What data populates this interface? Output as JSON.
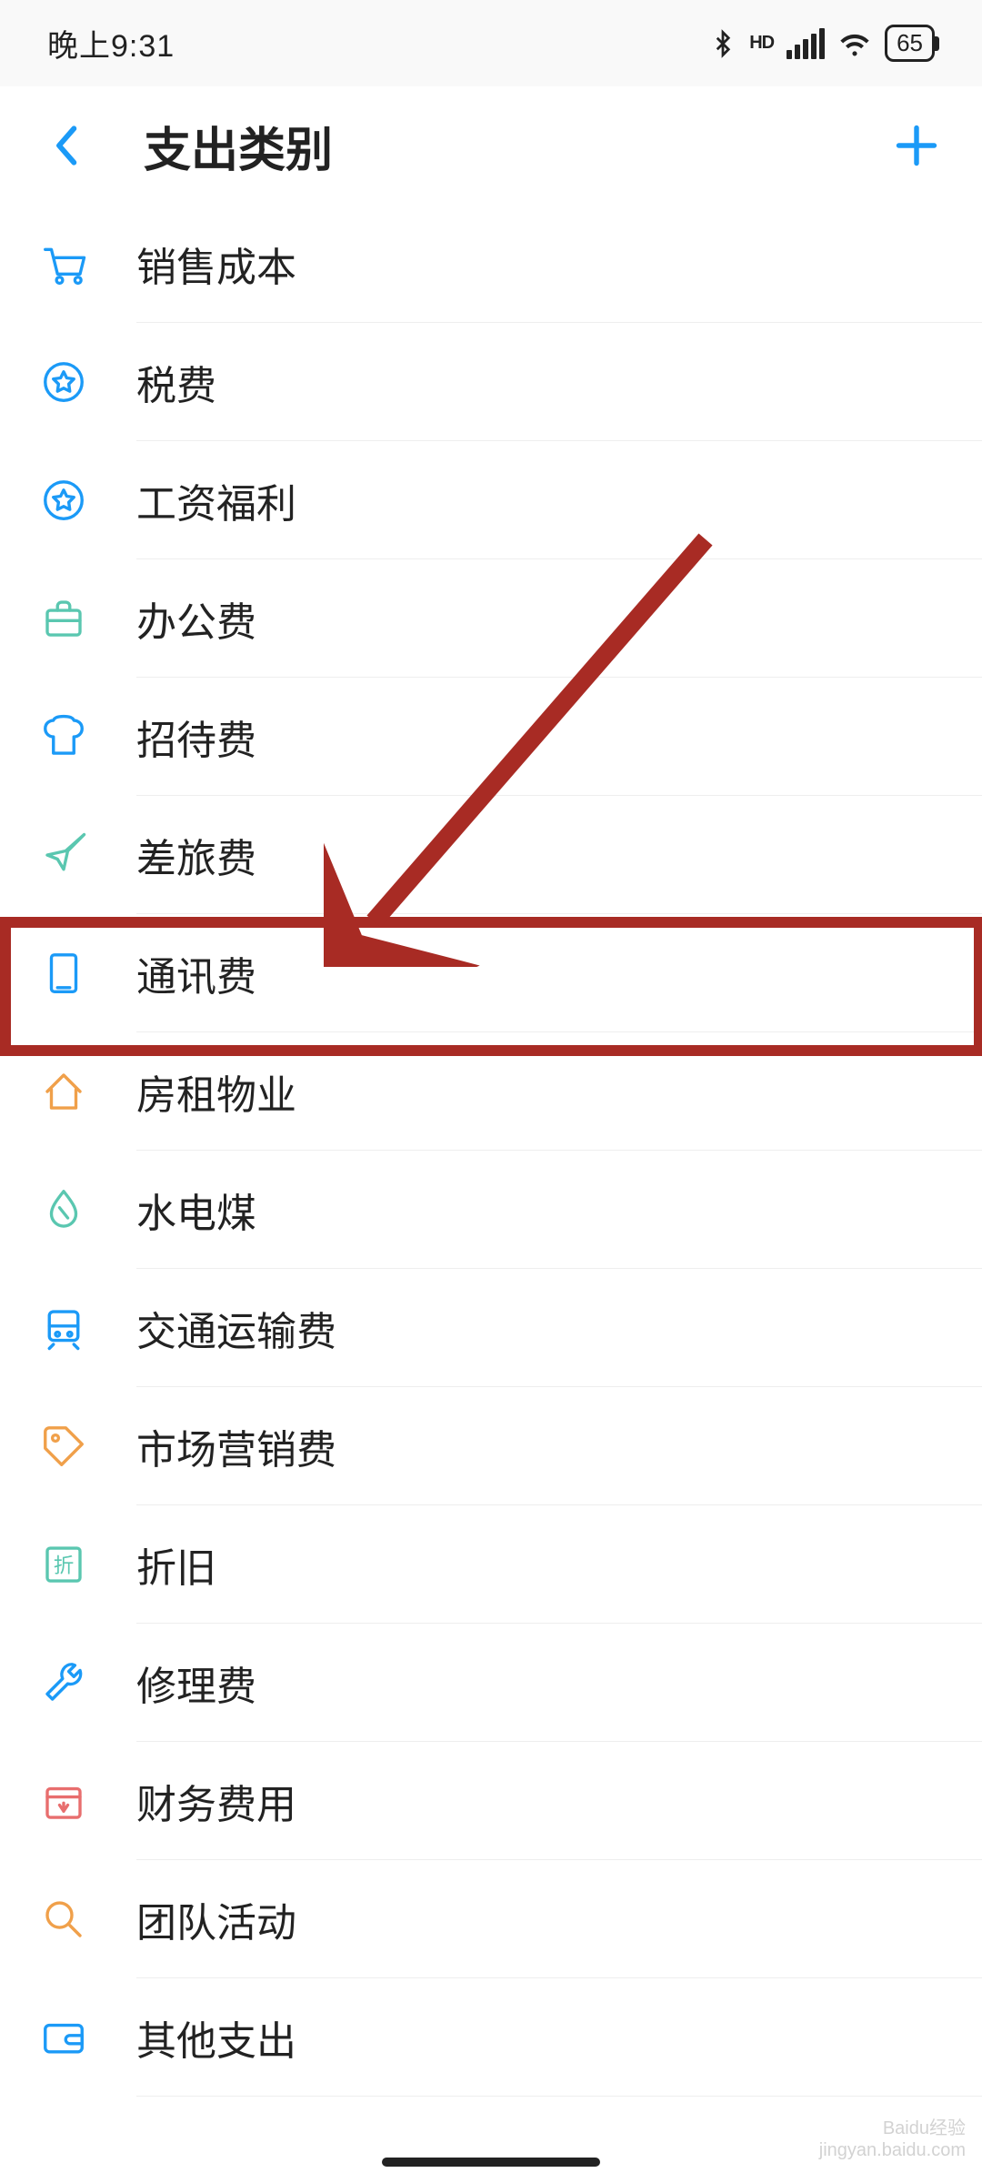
{
  "status": {
    "time": "晚上9:31",
    "battery": "65"
  },
  "header": {
    "title": "支出类别"
  },
  "categories": [
    {
      "label": "销售成本",
      "icon": "cart",
      "color": "#1b9af7"
    },
    {
      "label": "税费",
      "icon": "star-badge",
      "color": "#1b9af7"
    },
    {
      "label": "工资福利",
      "icon": "star-badge",
      "color": "#1b9af7"
    },
    {
      "label": "办公费",
      "icon": "briefcase",
      "color": "#5ac7b0"
    },
    {
      "label": "招待费",
      "icon": "chef-hat",
      "color": "#1b9af7"
    },
    {
      "label": "差旅费",
      "icon": "plane",
      "color": "#5ac7b0"
    },
    {
      "label": "通讯费",
      "icon": "tablet",
      "color": "#1b9af7"
    },
    {
      "label": "房租物业",
      "icon": "house",
      "color": "#f0a04a"
    },
    {
      "label": "水电煤",
      "icon": "water-drop",
      "color": "#5ac7b0"
    },
    {
      "label": "交通运输费",
      "icon": "train",
      "color": "#1b9af7"
    },
    {
      "label": "市场营销费",
      "icon": "tag",
      "color": "#f0a04a"
    },
    {
      "label": "折旧",
      "icon": "depreciation",
      "color": "#5ac7b0"
    },
    {
      "label": "修理费",
      "icon": "wrench",
      "color": "#1b9af7"
    },
    {
      "label": "财务费用",
      "icon": "money-box",
      "color": "#e86e6e"
    },
    {
      "label": "团队活动",
      "icon": "magnifier",
      "color": "#f0a04a"
    },
    {
      "label": "其他支出",
      "icon": "wallet",
      "color": "#1b9af7"
    }
  ],
  "highlighted_index": 6,
  "watermark": {
    "line1": "Baidu经验",
    "line2": "jingyan.baidu.com"
  }
}
